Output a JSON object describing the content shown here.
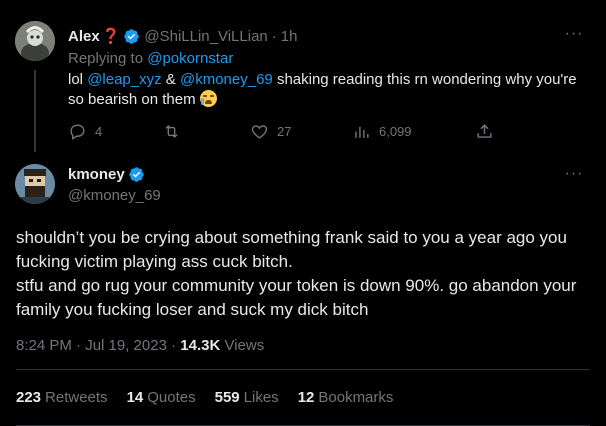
{
  "reply_tweet": {
    "display_name": "Alex",
    "name_emoji": "❓",
    "handle": "@ShiLLin_ViLLian",
    "time": "1h",
    "replying_prefix": "Replying to",
    "replying_to": "@pokornstar",
    "text_prefix": "lol",
    "mention_1": "@leap_xyz",
    "text_amp": "&",
    "mention_2": "@kmoney_69",
    "text_body": "shaking reading this rn wondering why you're so bearish on them",
    "emoji_icon": "loudly-crying-face",
    "replies": "4",
    "retweets": "",
    "likes": "27",
    "views": "6,099"
  },
  "main_tweet": {
    "display_name": "kmoney",
    "handle": "@kmoney_69",
    "text_line1": "shouldn’t you be crying about something frank said to you a year ago you fucking victim playing ass cuck bitch.",
    "text_line2": "stfu and go rug your community your token is down 90%. go abandon your family you fucking loser and suck my dick bitch",
    "timestamp": "8:24 PM · Jul 19, 2023",
    "views_count": "14.3K",
    "views_label": "Views",
    "stats": [
      {
        "count": "223",
        "label": "Retweets"
      },
      {
        "count": "14",
        "label": "Quotes"
      },
      {
        "count": "559",
        "label": "Likes"
      },
      {
        "count": "12",
        "label": "Bookmarks"
      }
    ]
  },
  "colors": {
    "background": "#000000",
    "text": "#e7e9ea",
    "muted": "#71767b",
    "link": "#1d9bf0",
    "verified": "#1d9bf0",
    "divider": "#2f3336"
  },
  "icons": {
    "more": "more-horizontal-icon",
    "verified": "verified-badge-icon",
    "reply": "reply-bubble-icon",
    "retweet": "retweet-icon",
    "like": "heart-icon",
    "views": "bar-chart-icon",
    "share": "share-icon"
  }
}
